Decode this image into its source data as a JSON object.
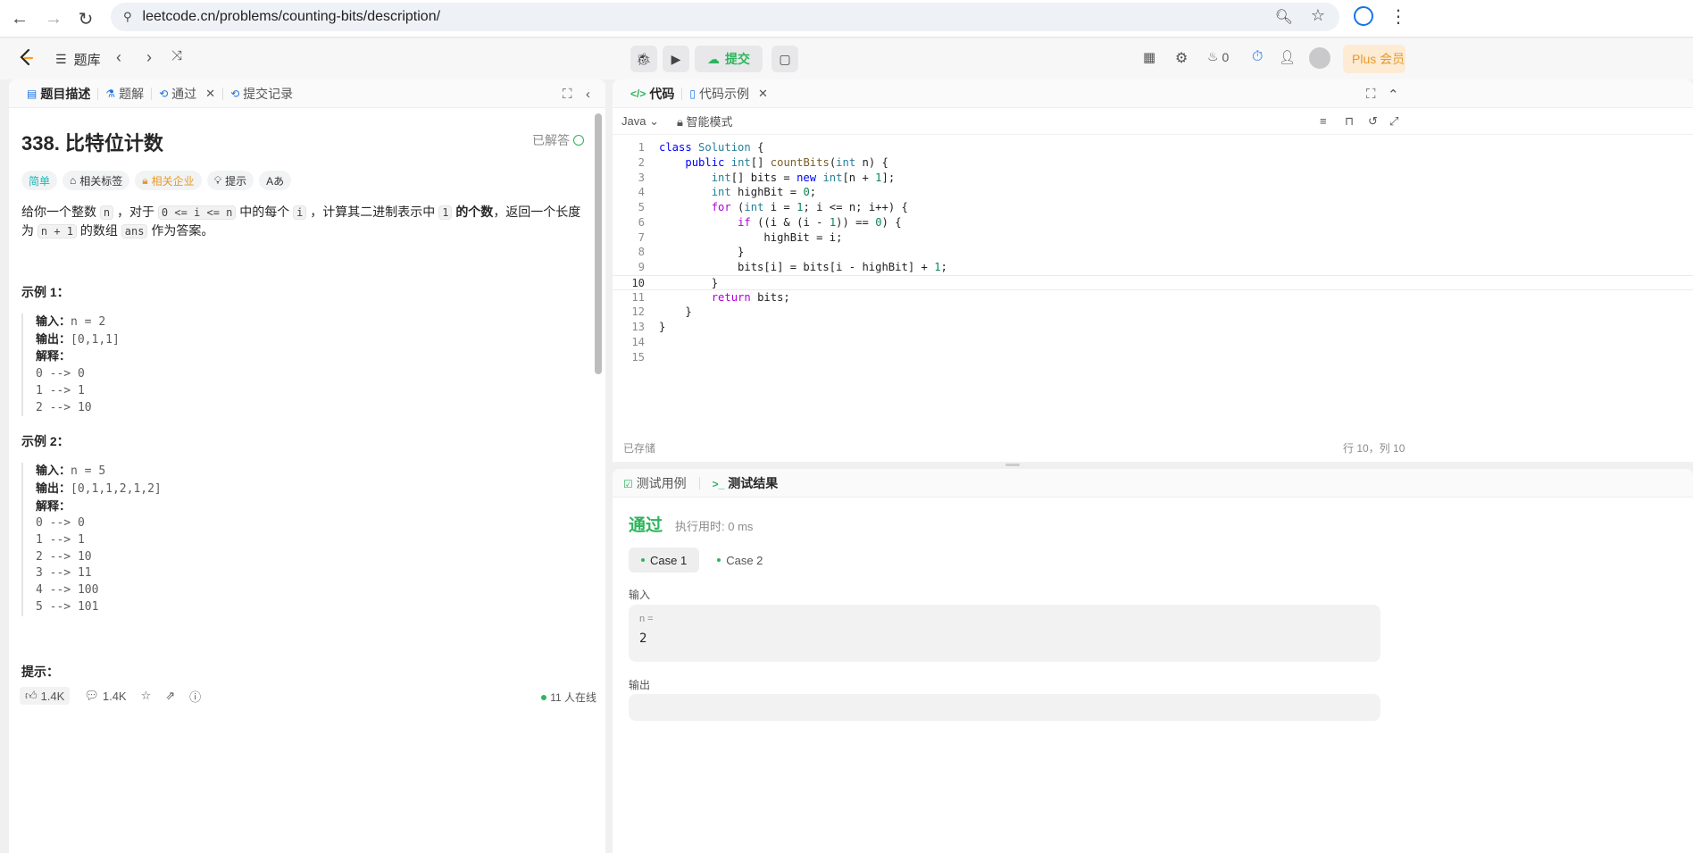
{
  "browser": {
    "url": "leetcode.cn/problems/counting-bits/description/"
  },
  "nav": {
    "problem_list": "题库",
    "submit": "提交",
    "streak_count": "0",
    "plus": "Plus 会员"
  },
  "left": {
    "tabs": [
      {
        "label": "题目描述"
      },
      {
        "label": "题解"
      },
      {
        "label": "通过"
      },
      {
        "label": "提交记录"
      }
    ],
    "title": "338. 比特位计数",
    "solved": "已解答",
    "tags": {
      "difficulty": "简单",
      "related_tags": "相关标签",
      "companies": "相关企业",
      "hint": "提示",
      "translate": "Aあ"
    },
    "desc": {
      "p1": "给你一个整数",
      "c1": "n",
      "p2": "，对于",
      "c2": "0 <= i <= n",
      "p3": "中的每个",
      "c3": "i",
      "p4": "，计算其二进制表示中",
      "c4": "1",
      "p5": "的个数",
      "p6": "，返回一个长度为",
      "c5": "n + 1",
      "p7": "的数组",
      "c6": "ans",
      "p8": "作为答案。"
    },
    "example1": {
      "title": "示例 1：",
      "input_label": "输入：",
      "input": "n = 2",
      "output_label": "输出：",
      "output": "[0,1,1]",
      "explain_label": "解释：",
      "lines": [
        "0 --> 0",
        "1 --> 1",
        "2 --> 10"
      ]
    },
    "example2": {
      "title": "示例 2：",
      "input_label": "输入：",
      "input": "n = 5",
      "output_label": "输出：",
      "output": "[0,1,1,2,1,2]",
      "explain_label": "解释：",
      "lines": [
        "0 --> 0",
        "1 --> 1",
        "2 --> 10",
        "3 --> 11",
        "4 --> 100",
        "5 --> 101"
      ]
    },
    "hints_title": "提示：",
    "footer": {
      "likes": "1.4K",
      "comments": "1.4K",
      "online": "11 人在线"
    }
  },
  "code_panel": {
    "tabs": [
      {
        "label": "代码"
      },
      {
        "label": "代码示例"
      }
    ],
    "language": "Java",
    "mode": "智能模式",
    "saved": "已存储",
    "cursor": "行 10，列 10",
    "current_line": 10
  },
  "result_panel": {
    "tabs": [
      {
        "label": "测试用例"
      },
      {
        "label": "测试结果"
      }
    ],
    "status": "通过",
    "runtime": "执行用时: 0 ms",
    "cases": [
      "Case 1",
      "Case 2"
    ],
    "input_label": "输入",
    "input_key": "n =",
    "input_value": "2",
    "output_label": "输出"
  },
  "colors": {
    "accent_green": "#2db55d",
    "easy_teal": "#1cb8b8",
    "premium_orange": "#e59b2b"
  }
}
